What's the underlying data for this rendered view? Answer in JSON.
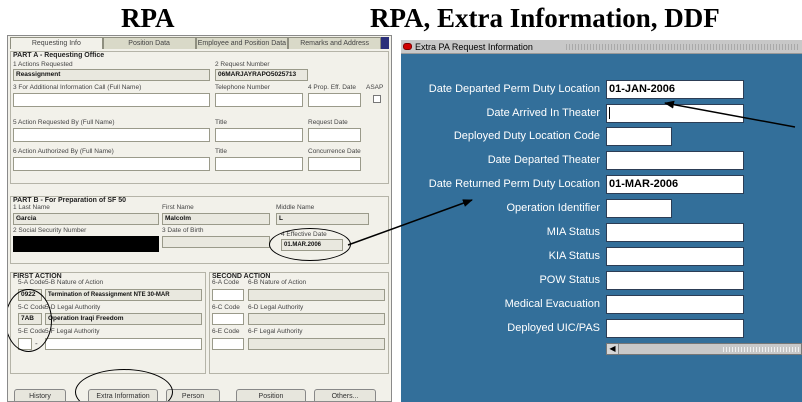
{
  "headings": {
    "left": "RPA",
    "right": "RPA, Extra Information, DDF"
  },
  "rpa": {
    "tabs": [
      "Requesting Info",
      "Position Data",
      "Employee and Position Data",
      "Remarks and Address"
    ],
    "part_a": {
      "title": "PART A - Requesting Office",
      "actions_requested_label": "1 Actions Requested",
      "actions_requested_value": "Reassignment",
      "request_number_label": "2 Request Number",
      "request_number_value": "06MARJAYRAPO5025713",
      "additional_info_label": "3 For Additional Information Call (Full Name)",
      "telephone_label": "Telephone Number",
      "prop_eff_date_label": "4 Prop. Eff. Date",
      "asap_label": "ASAP",
      "action_requested_by_label": "5 Action Requested By (Full Name)",
      "title_label": "Title",
      "request_date_label": "Request Date",
      "action_authorized_by_label": "6 Action Authorized By (Full Name)",
      "title2_label": "Title",
      "concurrence_date_label": "Concurrence Date"
    },
    "part_b": {
      "title": "PART B - For Preparation of SF 50",
      "last_name_label": "1 Last Name",
      "last_name_value": "Garcia",
      "first_name_label": "First Name",
      "first_name_value": "Malcolm",
      "middle_name_label": "Middle Name",
      "middle_name_value": "L",
      "ssn_label": "2 Social Security Number",
      "dob_label": "3 Date of Birth",
      "effective_date_label": "4 Effective Date",
      "effective_date_value": "01.MAR.2006"
    },
    "first_action": {
      "title": "FIRST ACTION",
      "code_5a_label": "5-A Code",
      "nature_5b_label": "5-B Nature of Action",
      "code_5a_value": "0922",
      "nature_5b_value": "Termination of Reassignment NTE 30-MAR",
      "code_5c_label": "5-C Code",
      "authority_5d_label": "5-D Legal Authority",
      "code_5c_value": "7AB",
      "authority_5d_value": "Operation Iraqi Freedom",
      "code_5e_label": "5-E Code",
      "authority_5f_label": "5-F Legal Authority",
      "dash": "-"
    },
    "second_action": {
      "title": "SECOND ACTION",
      "code_6a_label": "6-A Code",
      "nature_6b_label": "6-B Nature of Action",
      "code_6c_label": "6-C Code",
      "authority_6d_label": "6-D Legal Authority",
      "code_6e_label": "6-E Code",
      "authority_6f_label": "6-F Legal Authority"
    },
    "buttons": [
      "History",
      "Extra Information",
      "Person",
      "Position",
      "Others..."
    ]
  },
  "extra": {
    "window_title": "Extra PA Request Information",
    "fields": [
      {
        "label": "Date Departed Perm Duty Location",
        "value": "01-JAN-2006"
      },
      {
        "label": "Date Arrived In Theater",
        "value": ""
      },
      {
        "label": "Deployed Duty Location Code",
        "value": ""
      },
      {
        "label": "Date Departed Theater",
        "value": ""
      },
      {
        "label": "Date Returned  Perm Duty Location",
        "value": "01-MAR-2006"
      },
      {
        "label": "Operation Identifier",
        "value": ""
      },
      {
        "label": "MIA Status",
        "value": ""
      },
      {
        "label": "KIA Status",
        "value": ""
      },
      {
        "label": "POW Status",
        "value": ""
      },
      {
        "label": "Medical Evacuation",
        "value": ""
      },
      {
        "label": "Deployed UIC/PAS",
        "value": ""
      }
    ],
    "scroll_arrow": "◀"
  },
  "colors": {
    "window_bg": "#336f9a",
    "rpa_bg": "#f2f1ea",
    "title_icon": "#d10000"
  }
}
